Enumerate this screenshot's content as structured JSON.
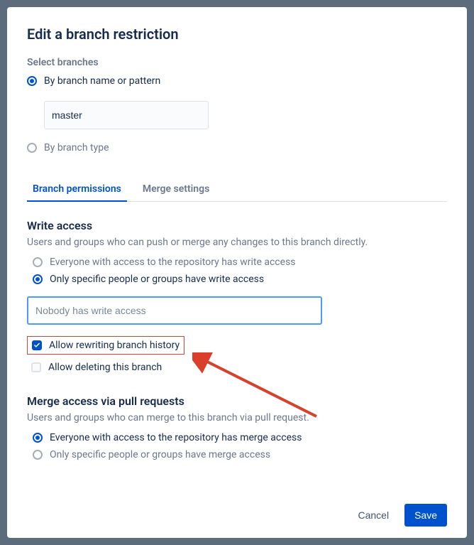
{
  "title": "Edit a branch restriction",
  "select_branches": {
    "label": "Select branches",
    "by_pattern": "By branch name or pattern",
    "branch_value": "master",
    "by_type": "By branch type"
  },
  "tabs": {
    "permissions": "Branch permissions",
    "merge": "Merge settings"
  },
  "write_access": {
    "title": "Write access",
    "desc": "Users and groups who can push or merge any changes to this branch directly.",
    "everyone": "Everyone with access to the repository has write access",
    "specific": "Only specific people or groups have write access",
    "placeholder": "Nobody has write access"
  },
  "checkboxes": {
    "rewrite": "Allow rewriting branch history",
    "delete": "Allow deleting this branch"
  },
  "merge_access": {
    "title": "Merge access via pull requests",
    "desc": "Users and groups who can merge to this branch via pull request.",
    "everyone": "Everyone with access to the repository has merge access",
    "specific": "Only specific people or groups have merge access"
  },
  "buttons": {
    "cancel": "Cancel",
    "save": "Save"
  }
}
